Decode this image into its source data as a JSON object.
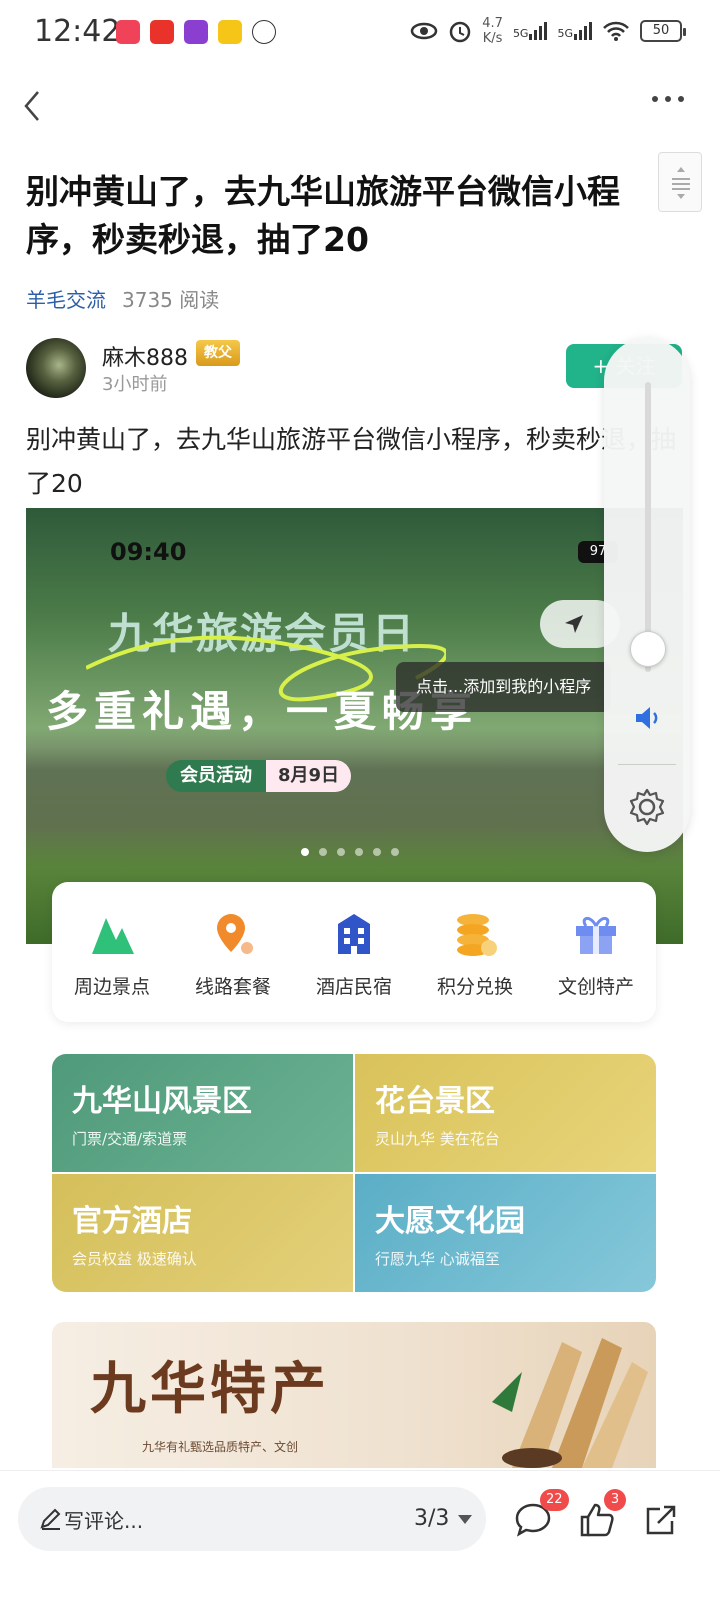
{
  "status_bar": {
    "time": "12:42",
    "net_speed": "4.7",
    "net_speed_unit": "K/s",
    "sim1": "5G",
    "sim2": "5G",
    "battery": "50"
  },
  "article": {
    "title": "别冲黄山了，去九华山旅游平台微信小程序，秒卖秒退，抽了20",
    "category": "羊毛交流",
    "read_count": "3735 阅读",
    "author_name": "麻木888",
    "author_badge": "教父",
    "post_time": "3小时前",
    "follow_label": "+ 关注",
    "body": "别冲黄山了，去九华山旅游平台微信小程序，秒卖秒退，抽了20"
  },
  "embedded_image": {
    "phone_time": "09:40",
    "phone_battery": "97",
    "banner_title": "九华旅游会员日",
    "banner_subtitle": "多重礼遇，一夏畅享",
    "tooltip": "点击...添加到我的小程序",
    "member_label": "会员活动",
    "member_date": "8月9日",
    "quick_entries": [
      {
        "label": "周边景点",
        "icon": "mountain-icon"
      },
      {
        "label": "线路套餐",
        "icon": "route-pin-icon"
      },
      {
        "label": "酒店民宿",
        "icon": "hotel-icon"
      },
      {
        "label": "积分兑换",
        "icon": "coins-icon"
      },
      {
        "label": "文创特产",
        "icon": "gift-icon"
      }
    ],
    "tiles": [
      {
        "title": "九华山风景区",
        "subtitle": "门票/交通/索道票",
        "color": "#4f9a7a"
      },
      {
        "title": "花台景区",
        "subtitle": "灵山九华  美在花台",
        "color": "#d9c25a"
      },
      {
        "title": "官方酒店",
        "subtitle": "会员权益  极速确认",
        "color": "#d4bf5a"
      },
      {
        "title": "大愿文化园",
        "subtitle": "行愿九华  心诚福至",
        "color": "#6bbbd0"
      }
    ],
    "specialty_title": "九华特产",
    "specialty_subtitle": "九华有礼甄选品质特产、文创"
  },
  "volume": {
    "level": 0.08
  },
  "bottom_bar": {
    "comment_placeholder": "写评论...",
    "page_indicator": "3/3",
    "comment_count": "22",
    "like_count": "3"
  }
}
